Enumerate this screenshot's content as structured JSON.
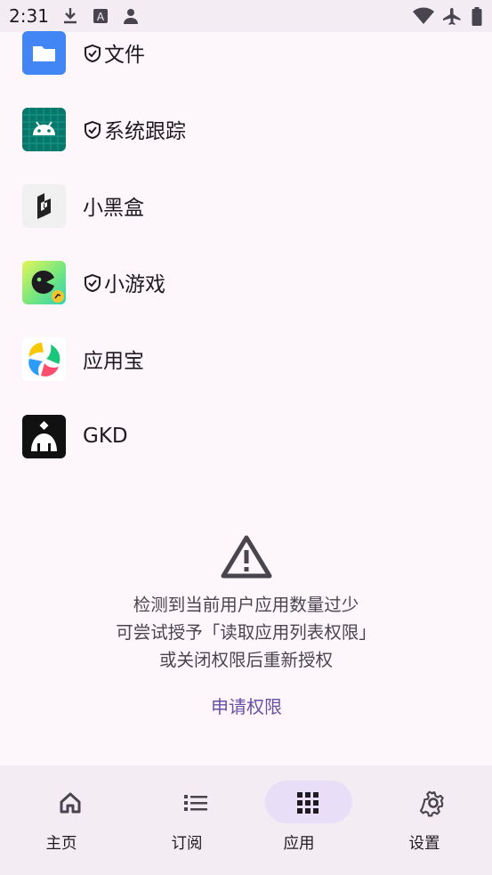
{
  "status_bar": {
    "time": "2:31",
    "left_icons": [
      "download-icon",
      "a-box-icon",
      "person-icon"
    ],
    "right_icons": [
      "wifi-icon",
      "airplane-icon",
      "battery-icon"
    ]
  },
  "apps": [
    {
      "label": "文件",
      "protected": true,
      "icon": "files-folder-icon"
    },
    {
      "label": "系统跟踪",
      "protected": true,
      "icon": "android-trace-icon"
    },
    {
      "label": "小黑盒",
      "protected": false,
      "icon": "heybox-icon"
    },
    {
      "label": "小游戏",
      "protected": true,
      "icon": "mini-game-icon"
    },
    {
      "label": "应用宝",
      "protected": false,
      "icon": "app-treasure-icon"
    },
    {
      "label": "GKD",
      "protected": false,
      "icon": "gkd-icon"
    }
  ],
  "empty_state": {
    "icon": "warning-icon",
    "lines": [
      "检测到当前用户应用数量过少",
      "可尝试授予「读取应用列表权限」",
      "或关闭权限后重新授权"
    ],
    "action_label": "申请权限"
  },
  "bottom_nav": [
    {
      "label": "主页",
      "icon": "home-icon",
      "active": false
    },
    {
      "label": "订阅",
      "icon": "list-icon",
      "active": false
    },
    {
      "label": "应用",
      "icon": "apps-grid-icon",
      "active": true
    },
    {
      "label": "设置",
      "icon": "gear-icon",
      "active": false
    }
  ],
  "colors": {
    "accent": "#6750a4",
    "nav_active": "#e8def8",
    "background": "#fdf7fc"
  }
}
